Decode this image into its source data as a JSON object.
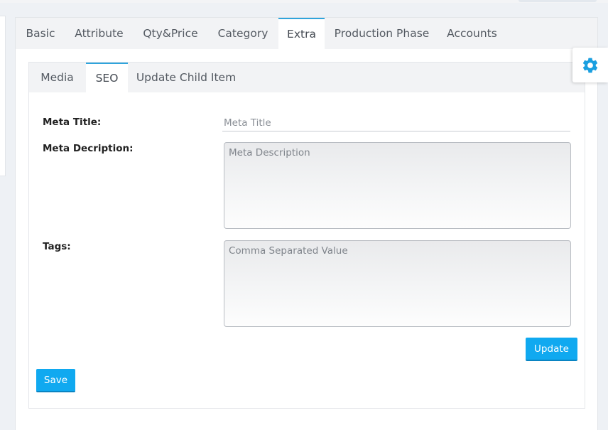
{
  "product_tabs": [
    {
      "label": "Basic",
      "active": false
    },
    {
      "label": "Attribute",
      "active": false
    },
    {
      "label": "Qty&Price",
      "active": false
    },
    {
      "label": "Category",
      "active": false
    },
    {
      "label": "Extra",
      "active": true
    },
    {
      "label": "Production Phase",
      "active": false
    },
    {
      "label": "Accounts",
      "active": false
    }
  ],
  "extra_tabs": [
    {
      "label": "Media",
      "active": false
    },
    {
      "label": "SEO",
      "active": true
    },
    {
      "label": "Update Child Item",
      "active": false
    }
  ],
  "seo_form": {
    "meta_title": {
      "label": "Meta Title:",
      "value": "",
      "placeholder": "Meta Title"
    },
    "meta_description": {
      "label": "Meta Decription:",
      "value": "",
      "placeholder": "Meta Description"
    },
    "tags": {
      "label": "Tags:",
      "value": "",
      "placeholder": "Comma Separated Value"
    },
    "update_label": "Update"
  },
  "save_label": "Save",
  "settings_icon": "gear-icon",
  "colors": {
    "accent": "#10a9f0",
    "tab_active_border": "#2fa4dc",
    "page_background": "#eef1f5"
  }
}
